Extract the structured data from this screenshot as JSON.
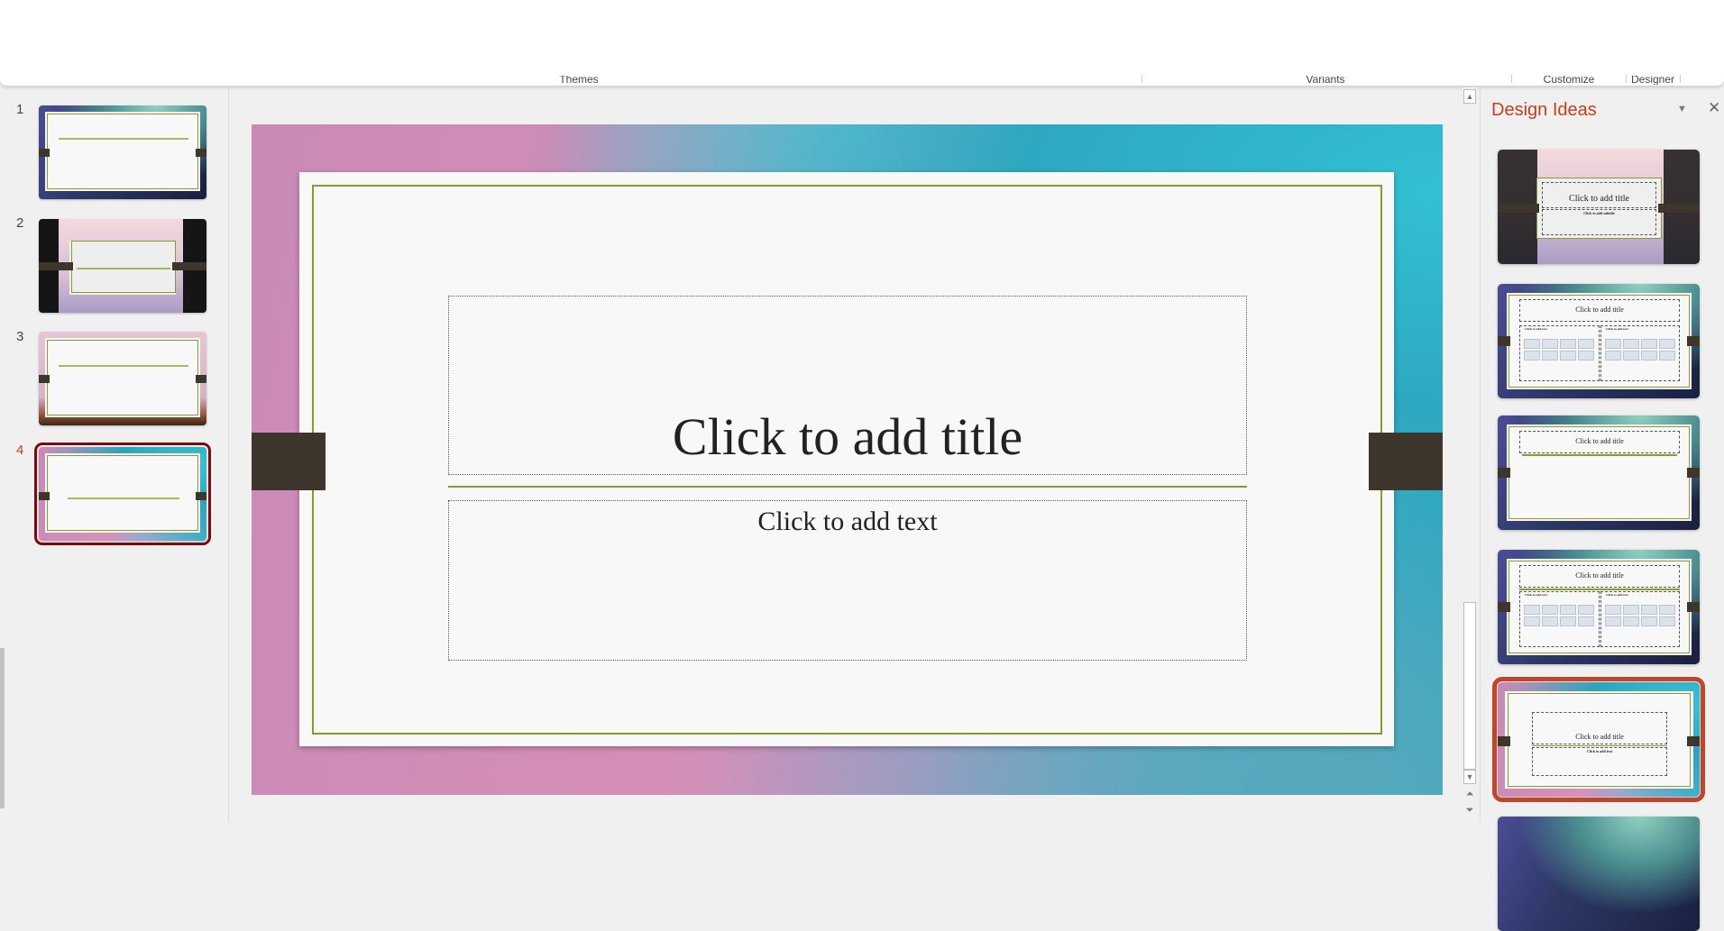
{
  "ribbon": {
    "groups": [
      "Themes",
      "Variants",
      "Customize",
      "Designer"
    ]
  },
  "slides_pane": {
    "items": [
      {
        "number": "1",
        "background": "aurora"
      },
      {
        "number": "2",
        "background": "construction"
      },
      {
        "number": "3",
        "background": "beach"
      },
      {
        "number": "4",
        "background": "pink-wave",
        "selected": true
      }
    ]
  },
  "slide": {
    "title_placeholder": "Click to add title",
    "text_placeholder": "Click to add text"
  },
  "design_ideas": {
    "title": "Design Ideas",
    "dropdown_icon": "triangle-down-icon",
    "close_icon": "close-icon",
    "items": [
      {
        "title": "Click to add title",
        "subtitle": "Click to add subtitle",
        "background": "construction"
      },
      {
        "title": "Click to add title",
        "left_text": "Click to add text",
        "right_text": "Click to add text",
        "background": "aurora"
      },
      {
        "title": "Click to add title",
        "background": "aurora"
      },
      {
        "title": "Click to add title",
        "left_text": "Click to add text",
        "right_text": "Click to add text",
        "background": "aurora"
      },
      {
        "title": "Click to add title",
        "subtitle": "Click to add text",
        "background": "pink-wave",
        "selected": true
      }
    ]
  },
  "colors": {
    "accent": "#c43e1c",
    "frame": "#8a9a2c",
    "tab": "#3e352d",
    "selected_slide": "#7a0a12",
    "selected_idea": "#c0452a"
  }
}
